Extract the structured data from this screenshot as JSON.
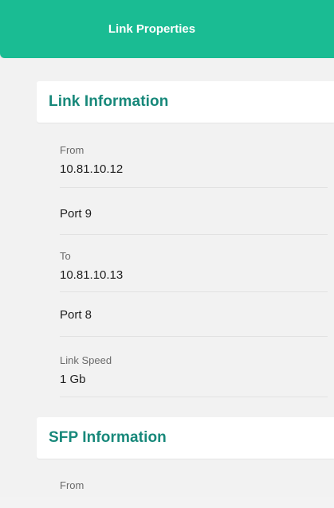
{
  "header": {
    "title": "Link Properties"
  },
  "link_information": {
    "title": "Link Information",
    "rows": [
      {
        "label": "From",
        "value": "10.81.10.12"
      },
      {
        "label": "",
        "value": "Port 9"
      },
      {
        "label": "To",
        "value": "10.81.10.13"
      },
      {
        "label": "",
        "value": "Port 8"
      },
      {
        "label": "Link Speed",
        "value": "1 Gb"
      }
    ]
  },
  "sfp_information": {
    "title": "SFP Information",
    "rows": [
      {
        "label": "From",
        "value": ""
      }
    ]
  },
  "colors": {
    "header_bg": "#1abc93",
    "section_title": "#17887a",
    "panel_bg": "#f2f2f2"
  }
}
